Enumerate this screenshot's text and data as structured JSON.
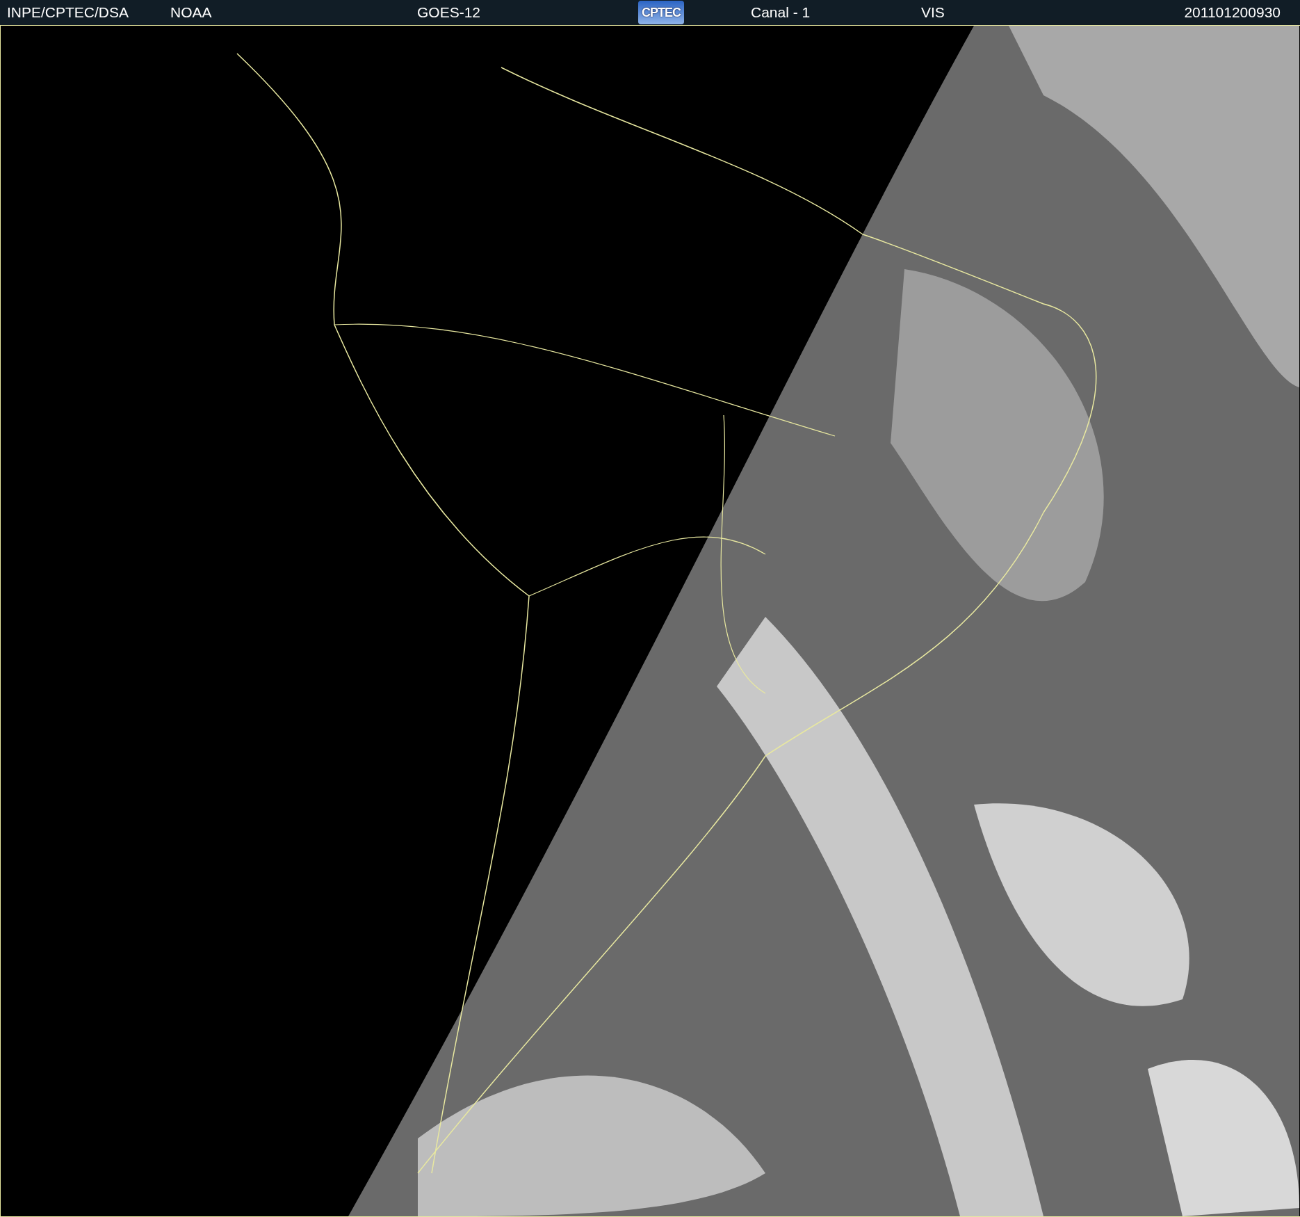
{
  "header": {
    "items": [
      "INPE/CPTEC/DSA",
      "NOAA",
      "GOES-12"
    ],
    "logo": "CPTEC",
    "channel": "Canal - 1",
    "band": "VIS",
    "timestamp": "201101200930"
  }
}
